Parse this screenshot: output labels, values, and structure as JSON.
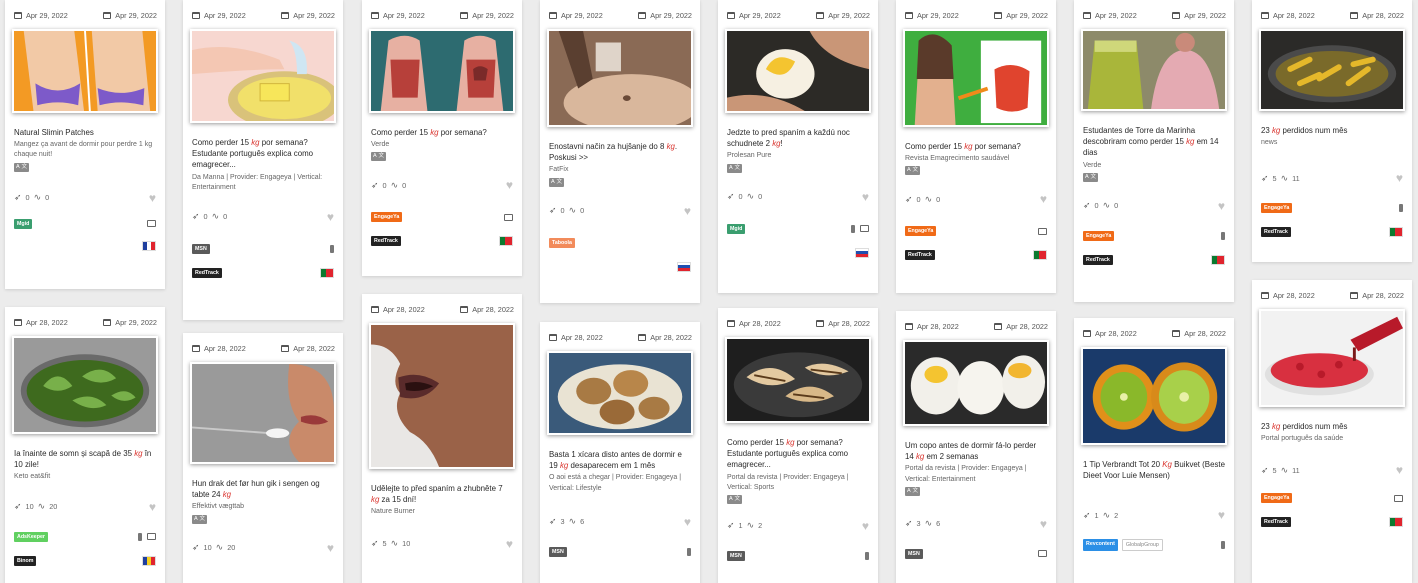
{
  "accent": {
    "kg": "#d9312b",
    "mgid": "#3a9e6f",
    "engageya": "#f06a17",
    "redtrack": "#222222",
    "msn": "#5a5a5a",
    "taboola": "#f28b5b",
    "adskeeper": "#60d060",
    "revcontent": "#2b8fe6"
  },
  "cards": [
    {
      "date1": "Apr 29, 2022",
      "date2": "Apr 29, 2022",
      "title": "Natural Slimin Patches",
      "source": "Mangez ça avant de dormir pour perdre 1 kg chaque nuit!",
      "chip": "A 文",
      "saves": "0",
      "trend": "0",
      "badge": "Mgid",
      "flag": "fr"
    },
    {
      "date1": "Apr 29, 2022",
      "date2": "Apr 29, 2022",
      "t1": "Como perder 15 ",
      "kg": "kg",
      "t2": " por semana? Estudante português explica como emagrecer...",
      "source": "Da Manna | Provider: Engageya | Vertical: Entertainment",
      "chip": "A 文",
      "saves": "0",
      "trend": "0",
      "badge": "MSN",
      "badge2": "RedTrack",
      "flag": "pt"
    },
    {
      "date1": "Apr 29, 2022",
      "date2": "Apr 29, 2022",
      "t1": "Como perder 15 ",
      "kg": "kg",
      "t2": " por semana?",
      "source": "Verde",
      "chip": "A 文",
      "saves": "0",
      "trend": "0",
      "badge": "EngageYa",
      "badge2": "RedTrack",
      "flag": "pt"
    },
    {
      "date1": "Apr 29, 2022",
      "date2": "Apr 29, 2022",
      "t1": "Enostavni način za hujšanje do 8 ",
      "kg": "kg",
      "t2": ". Poskusi >>",
      "source": "FatFix",
      "chip": "A 文",
      "saves": "0",
      "trend": "0",
      "badge": "Taboola",
      "flag": "si"
    },
    {
      "date1": "Apr 29, 2022",
      "date2": "Apr 29, 2022",
      "t1": "Jedzte to pred spaním a každú noc schudnete 2 ",
      "kg": "kg",
      "t2": "!",
      "source": "Prolesan Pure",
      "chip": "A 文",
      "saves": "0",
      "trend": "0",
      "badge": "Mgid",
      "flag": "sk"
    },
    {
      "date1": "Apr 29, 2022",
      "date2": "Apr 29, 2022",
      "t1": "Como perder 15 ",
      "kg": "kg",
      "t2": " por semana?",
      "source": "Revista Emagrecimento saudável",
      "chip": "A 文",
      "saves": "0",
      "trend": "0",
      "badge": "EngageYa",
      "badge2": "RedTrack",
      "flag": "pt"
    },
    {
      "date1": "Apr 29, 2022",
      "date2": "Apr 29, 2022",
      "t1": "Estudantes de Torre da Marinha descobriram como perder 15 ",
      "kg": "kg",
      "t2": " em 14 dias",
      "source": "Verde",
      "chip": "A 文",
      "saves": "0",
      "trend": "0",
      "badge": "EngageYa",
      "badge2": "RedTrack",
      "flag": "pt"
    },
    {
      "date1": "Apr 28, 2022",
      "date2": "Apr 28, 2022",
      "t1": "23 ",
      "kg": "kg",
      "t2": " perdidos num mês",
      "source": "news",
      "chip": "",
      "saves": "5",
      "trend": "11",
      "badge": "EngageYa",
      "badge2": "RedTrack",
      "flag": "pt"
    },
    {
      "date1": "Apr 28, 2022",
      "date2": "Apr 29, 2022",
      "t1": "Ia înainte de somn și scapă de 35 ",
      "kg": "kg",
      "t2": " în 10 zile!",
      "source": "Keto eat&fit",
      "chip": "",
      "saves": "10",
      "trend": "20",
      "badge": "AdsKeeper",
      "badge2": "Binom",
      "flag": "ro"
    },
    {
      "date1": "Apr 28, 2022",
      "date2": "Apr 28, 2022",
      "t1": "Hun drak det før hun gik i sengen og tabte 24 ",
      "kg": "kg",
      "t2": "",
      "source": "Effektivt vægttab",
      "chip": "A 文",
      "saves": "10",
      "trend": "20"
    },
    {
      "date1": "Apr 28, 2022",
      "date2": "Apr 28, 2022",
      "t1": "Udělejte to před spaním a zhubněte 7 ",
      "kg": "kg",
      "t2": " za 15 dní!",
      "source": "Nature Burner",
      "chip": "",
      "saves": "5",
      "trend": "10"
    },
    {
      "date1": "Apr 28, 2022",
      "date2": "Apr 28, 2022",
      "t1": "Basta 1 xícara disto antes de dormir e 19 ",
      "kg": "kg",
      "t2": " desaparecem em 1 mês",
      "source": "O aoi está a chegar | Provider: Engageya | Vertical: Lifestyle",
      "chip": "",
      "saves": "3",
      "trend": "6",
      "badge": "MSN"
    },
    {
      "date1": "Apr 28, 2022",
      "date2": "Apr 28, 2022",
      "t1": "Como perder 15 ",
      "kg": "kg",
      "t2": " por semana? Estudante português explica como emagrecer...",
      "source": "Portal da revista | Provider: Engageya | Vertical: Sports",
      "chip": "A 文",
      "saves": "1",
      "trend": "2",
      "badge": "MSN"
    },
    {
      "date1": "Apr 28, 2022",
      "date2": "Apr 28, 2022",
      "t1": "Um copo antes de dormir fá-lo perder 14 ",
      "kg": "kg",
      "t2": " em 2 semanas",
      "source": "Portal da revista | Provider: Engageya | Vertical: Entertainment",
      "chip": "A 文",
      "saves": "3",
      "trend": "6",
      "badge": "MSN"
    },
    {
      "date1": "Apr 28, 2022",
      "date2": "Apr 28, 2022",
      "t1": "1 Tip Verbrandt Tot 20 ",
      "kg": "Kg",
      "t2": " Buikvet (Beste Dieet Voor Luie Mensen)",
      "source": "",
      "chip": "",
      "saves": "1",
      "trend": "2",
      "badge": "Revcontent",
      "badge2": "GlobalpGroup"
    },
    {
      "date1": "Apr 28, 2022",
      "date2": "Apr 28, 2022",
      "t1": "23 ",
      "kg": "kg",
      "t2": " perdidos num mês",
      "source": "Portal português da saúde",
      "chip": "",
      "saves": "5",
      "trend": "11",
      "badge": "EngageYa",
      "badge2": "RedTrack",
      "flag": "pt"
    }
  ]
}
